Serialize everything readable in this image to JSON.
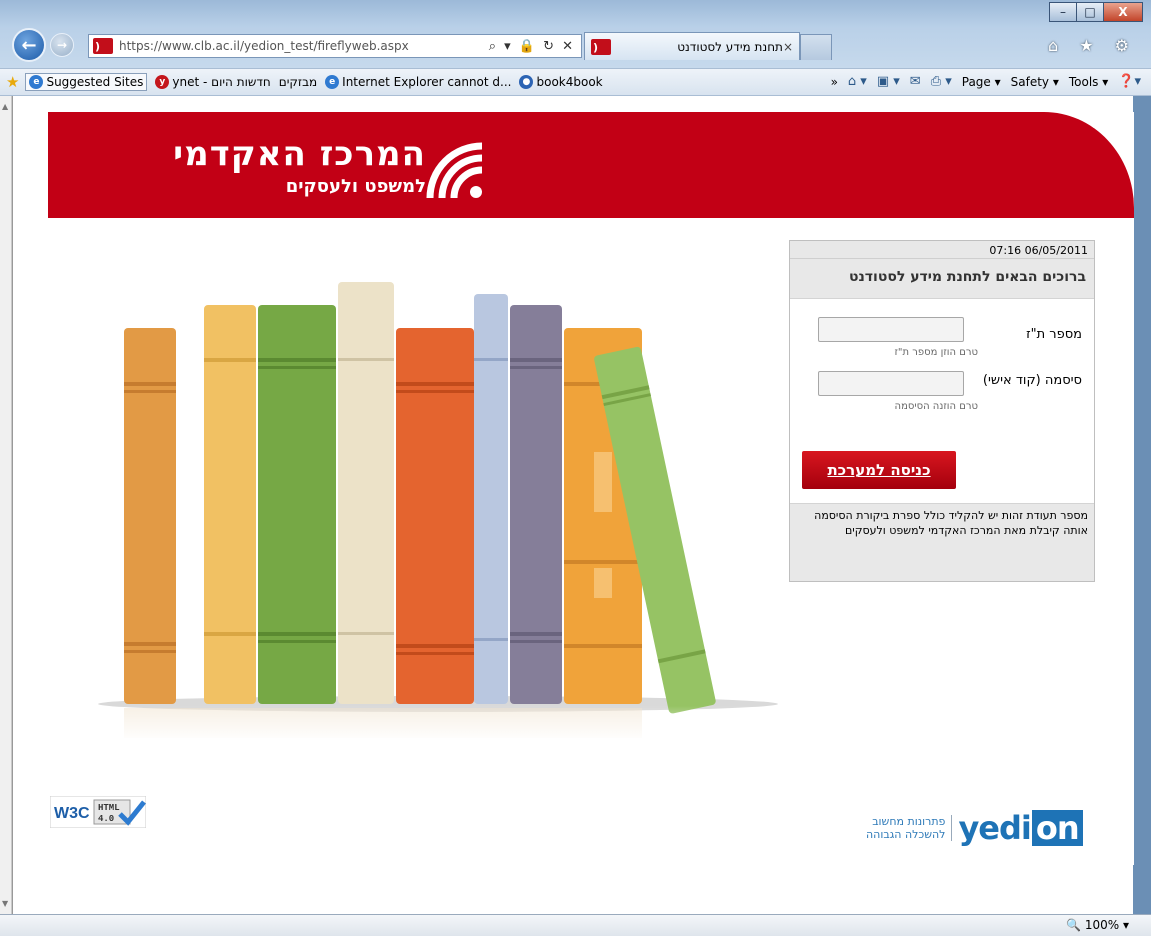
{
  "browser": {
    "window_controls": {
      "minimize": "–",
      "maximize": "□",
      "close": "X"
    },
    "address_url": "https://www.clb.ac.il/yedion_test/fireflyweb.aspx",
    "address_tools": "⌕ ▾ 🔒 ↻ ✕",
    "tab_title": "תחנת מידע לסטודנט",
    "tab_close": "×",
    "right_icons": "⌂ ★ ⚙",
    "favorites": [
      "Suggested Sites",
      "ynet - חדשות היום",
      "מבזקים",
      "Internet Explorer cannot d...",
      "book4book"
    ],
    "command_bar": [
      "Page ▾",
      "Safety ▾",
      "Tools ▾"
    ],
    "chevrons": "»",
    "zoom": "100%",
    "zoom_arrow": "▾"
  },
  "page": {
    "logo_main": "המרכז האקדמי",
    "logo_sub": "למשפט ולעסקים",
    "login": {
      "datetime": "07:16 06/05/2011",
      "title": "ברוכים הבאים לתחנת מידע לסטודנט",
      "id_label": "מספר ת\"ז",
      "id_hint": "טרם הוזן מספר ת\"ז",
      "id_value": "",
      "password_label": "סיסמה (קוד אישי)",
      "password_hint": "טרם הוזנה הסיסמה",
      "password_value": "",
      "submit": "כניסה למערכת",
      "note": "מספר תעודת זהות יש להקליד כולל ספרת ביקורת הסיסמה אותה קיבלת מאת המרכז האקדמי למשפט ולעסקים"
    },
    "footer": {
      "w3c": "W3C",
      "html_badge_line1": "HTML",
      "html_badge_line2": "4.0",
      "yedion_tag_line1": "פתרונות מחשוב",
      "yedion_tag_line2": "להשכלה הגבוהה",
      "yedion_word": "yedi",
      "yedion_on": "on"
    }
  },
  "colors": {
    "brand_red": "#c20015",
    "button_red": "#d8161f",
    "yedion_blue": "#1e73b6"
  }
}
